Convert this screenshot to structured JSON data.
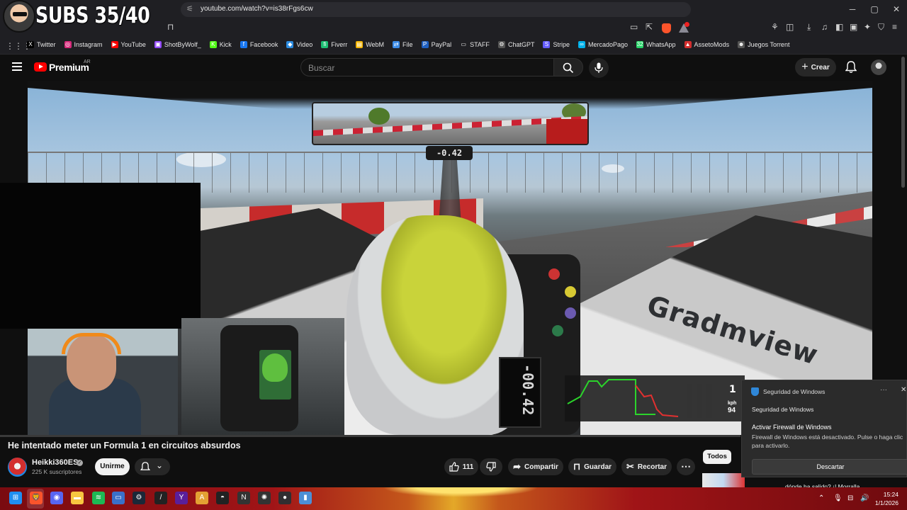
{
  "overlay": {
    "subs": "SUBS 35/40"
  },
  "browser": {
    "url": "youtube.com/watch?v=is38rFgs6cw",
    "window_controls": [
      "─",
      "▢",
      "✕"
    ]
  },
  "bookmarks": [
    {
      "label": "Twitter",
      "icon": "x-icon",
      "color": "#000000",
      "glyph": "X"
    },
    {
      "label": "Instagram",
      "icon": "instagram-icon",
      "color": "#d6287a",
      "glyph": "◎"
    },
    {
      "label": "YouTube",
      "icon": "youtube-icon",
      "color": "#ff0000",
      "glyph": "▶"
    },
    {
      "label": "ShotByWolf_",
      "icon": "twitch-icon",
      "color": "#9146ff",
      "glyph": "▣"
    },
    {
      "label": "Kick",
      "icon": "kick-icon",
      "color": "#53fc18",
      "glyph": "K"
    },
    {
      "label": "Facebook",
      "icon": "facebook-icon",
      "color": "#1877f2",
      "glyph": "f"
    },
    {
      "label": "Video",
      "icon": "video-icon",
      "color": "#2b8be0",
      "glyph": "◆"
    },
    {
      "label": "Fiverr",
      "icon": "fiverr-icon",
      "color": "#1dbf73",
      "glyph": "fi"
    },
    {
      "label": "WebM",
      "icon": "webm-icon",
      "color": "#f4b400",
      "glyph": "▤"
    },
    {
      "label": "File",
      "icon": "file-icon",
      "color": "#3c8ce7",
      "glyph": "⇄"
    },
    {
      "label": "PayPal",
      "icon": "paypal-icon",
      "color": "#1f5fbf",
      "glyph": "P"
    },
    {
      "label": "STAFF",
      "icon": "folder-icon",
      "color": "#1f1f23",
      "glyph": "▭"
    },
    {
      "label": "ChatGPT",
      "icon": "chatgpt-icon",
      "color": "#555555",
      "glyph": "⚙"
    },
    {
      "label": "Stripe",
      "icon": "stripe-icon",
      "color": "#635bff",
      "glyph": "S"
    },
    {
      "label": "MercadoPago",
      "icon": "mercadopago-icon",
      "color": "#00b1ea",
      "glyph": "∞"
    },
    {
      "label": "WhatsApp",
      "icon": "whatsapp-icon",
      "color": "#25d366",
      "glyph": "32"
    },
    {
      "label": "AssetoMods",
      "icon": "assetomods-icon",
      "color": "#d32f2f",
      "glyph": "▲"
    },
    {
      "label": "Juegos Torrent",
      "icon": "torrent-icon",
      "color": "#555555",
      "glyph": "☻"
    }
  ],
  "youtube": {
    "brand": "Premium",
    "country": "AR",
    "search_placeholder": "Buscar",
    "create_label": "Crear"
  },
  "video": {
    "mirror_delta": "-0.42",
    "wheel_delta": "-00.42",
    "gear": "1",
    "kph_label": "kph",
    "speed": "94",
    "sponsor_text": "Gradmview",
    "title": "He intentado meter un Formula 1 en circuitos absurdos"
  },
  "channel": {
    "name": "Heikki360ES",
    "subscribers": "225 K suscriptores",
    "join_label": "Unirme"
  },
  "actions": {
    "likes": "111",
    "share": "Compartir",
    "save": "Guardar",
    "clip": "Recortar"
  },
  "sidebar": {
    "filter_all": "Todos",
    "rec_title": "dónde ha salido? ¡! Morralla"
  },
  "toast": {
    "app": "Seguridad de Windows",
    "source": "Seguridad de Windows",
    "heading": "Activar Firewall de Windows",
    "body": "Firewall de Windows está desactivado. Pulse o haga clic para activarlo.",
    "button": "Descartar"
  },
  "taskbar": {
    "time": "15:24",
    "date": "1/1/2026",
    "apps": [
      {
        "name": "windows-start-icon",
        "color": "#1f8ef1",
        "glyph": "⊞"
      },
      {
        "name": "brave-icon",
        "color": "#fb542b",
        "glyph": "🦁"
      },
      {
        "name": "discord-icon",
        "color": "#5865f2",
        "glyph": "◉"
      },
      {
        "name": "file-explorer-icon",
        "color": "#f8c640",
        "glyph": "▬"
      },
      {
        "name": "spotify-icon",
        "color": "#1db954",
        "glyph": "≋"
      },
      {
        "name": "messaging-icon",
        "color": "#3a70c9",
        "glyph": "▭"
      },
      {
        "name": "steam-icon",
        "color": "#1b2838",
        "glyph": "⚙"
      },
      {
        "name": "slash-app-icon",
        "color": "#222222",
        "glyph": "/"
      },
      {
        "name": "y-app-icon",
        "color": "#5a1f9a",
        "glyph": "Y"
      },
      {
        "name": "ae-app-icon",
        "color": "#e3a033",
        "glyph": "A"
      },
      {
        "name": "mask-app-icon",
        "color": "#222222",
        "glyph": "◓"
      },
      {
        "name": "n-app-icon",
        "color": "#333333",
        "glyph": "N"
      },
      {
        "name": "chatgpt-app-icon",
        "color": "#333333",
        "glyph": "✺"
      },
      {
        "name": "obs-icon",
        "color": "#302e31",
        "glyph": "●"
      },
      {
        "name": "trash-app-icon",
        "color": "#4c8fd6",
        "glyph": "▮"
      }
    ]
  }
}
